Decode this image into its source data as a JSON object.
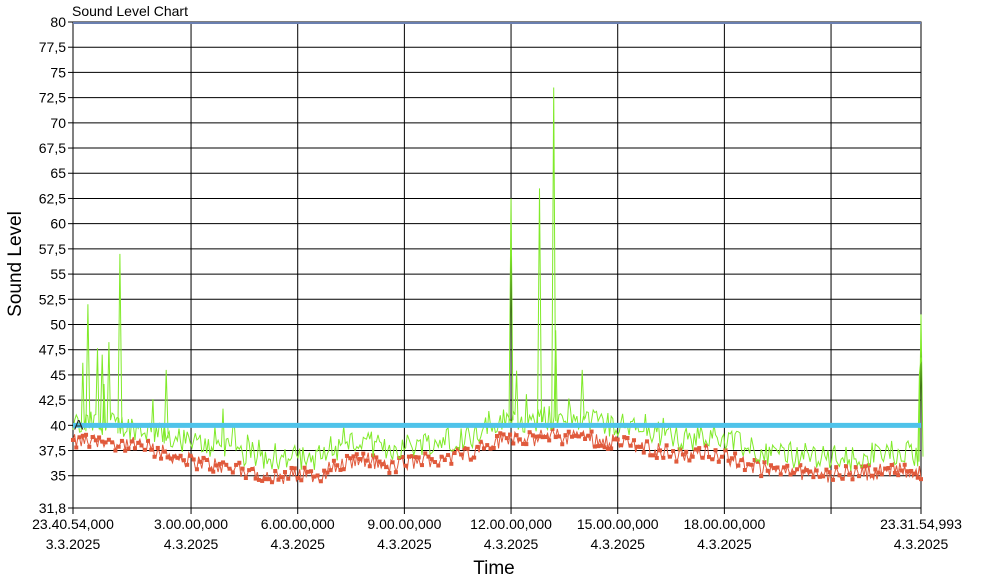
{
  "chart_data": {
    "type": "line",
    "title": "Sound Level Chart",
    "xlabel": "Time",
    "ylabel": "Sound Level",
    "ylim": [
      31.8,
      80
    ],
    "yticks": [
      "31,8",
      "35",
      "37,5",
      "40",
      "42,5",
      "45",
      "47,5",
      "50",
      "52,5",
      "55",
      "57,5",
      "60",
      "62,5",
      "65",
      "67,5",
      "70",
      "72,5",
      "75",
      "77,5",
      "80"
    ],
    "ytick_values": [
      31.8,
      35,
      37.5,
      40,
      42.5,
      45,
      47.5,
      50,
      52.5,
      55,
      57.5,
      60,
      62.5,
      65,
      67.5,
      70,
      72.5,
      75,
      77.5,
      80
    ],
    "x_range_hours": [
      -0.32,
      23.53
    ],
    "xtick_hours": [
      -0.32,
      3,
      6,
      9,
      12,
      15,
      18,
      21,
      23.53
    ],
    "xticks": [
      {
        "time": "23.40.54,000",
        "date": "3.3.2025"
      },
      {
        "time": "3.00.00,000",
        "date": "4.3.2025"
      },
      {
        "time": "6.00.00,000",
        "date": "4.3.2025"
      },
      {
        "time": "9.00.00,000",
        "date": "4.3.2025"
      },
      {
        "time": "12.00.00,000",
        "date": "4.3.2025"
      },
      {
        "time": "15.00.00,000",
        "date": "4.3.2025"
      },
      {
        "time": "18.00.00,000",
        "date": "4.3.2025"
      },
      {
        "time": "",
        "date": ""
      },
      {
        "time": "23.31.54,993",
        "date": "4.3.2025"
      }
    ],
    "threshold": {
      "label": "A",
      "value": 40,
      "color": "#4fc3ea"
    },
    "series": [
      {
        "color": "#80ea2a",
        "points": [
          [
            -0.32,
            38.5
          ],
          [
            0.1,
            52
          ],
          [
            0.5,
            47
          ],
          [
            1.0,
            57
          ],
          [
            1.4,
            45
          ],
          [
            1.8,
            42
          ],
          [
            2.3,
            45.5
          ],
          [
            2.8,
            41
          ],
          [
            3.5,
            39
          ],
          [
            4.2,
            39.5
          ],
          [
            4.8,
            37
          ],
          [
            5.3,
            36.2
          ],
          [
            5.7,
            35.1
          ],
          [
            6.2,
            35.5
          ],
          [
            6.6,
            35.3
          ],
          [
            7.0,
            38.5
          ],
          [
            7.4,
            37.8
          ],
          [
            7.8,
            38
          ],
          [
            8.2,
            37.2
          ],
          [
            8.6,
            36.5
          ],
          [
            9.0,
            36.8
          ],
          [
            9.5,
            37.5
          ],
          [
            10.0,
            37.8
          ],
          [
            10.6,
            37.5
          ],
          [
            11.2,
            38.5
          ],
          [
            11.6,
            39.5
          ],
          [
            12.0,
            62.5
          ],
          [
            12.4,
            42.5
          ],
          [
            12.8,
            63.5
          ],
          [
            13.2,
            73.5
          ],
          [
            13.6,
            44
          ],
          [
            14.0,
            45.5
          ],
          [
            14.5,
            39
          ],
          [
            15.0,
            41
          ],
          [
            15.5,
            39
          ],
          [
            16.0,
            38.5
          ],
          [
            16.5,
            38
          ],
          [
            17.0,
            37.5
          ],
          [
            17.5,
            38.5
          ],
          [
            18.0,
            38.8
          ],
          [
            18.5,
            37
          ],
          [
            19.0,
            36.2
          ],
          [
            19.5,
            35.8
          ],
          [
            20.0,
            35.6
          ],
          [
            20.5,
            35.5
          ],
          [
            21.0,
            35.3
          ],
          [
            21.5,
            35.4
          ],
          [
            22.0,
            35.6
          ],
          [
            22.5,
            35.7
          ],
          [
            23.0,
            35.9
          ],
          [
            23.53,
            51
          ]
        ]
      },
      {
        "color": "#e05a3c",
        "points": [
          [
            -0.32,
            38.3
          ],
          [
            0.5,
            38.5
          ],
          [
            1.0,
            38.2
          ],
          [
            1.5,
            38
          ],
          [
            2.0,
            37.5
          ],
          [
            2.5,
            37
          ],
          [
            3.0,
            36.5
          ],
          [
            3.5,
            36.2
          ],
          [
            4.0,
            35.8
          ],
          [
            4.5,
            35.4
          ],
          [
            5.0,
            35.2
          ],
          [
            5.5,
            34.9
          ],
          [
            6.0,
            35.1
          ],
          [
            6.5,
            35.0
          ],
          [
            7.0,
            35.8
          ],
          [
            7.5,
            36.5
          ],
          [
            8.0,
            36.5
          ],
          [
            8.5,
            35.8
          ],
          [
            9.0,
            36.2
          ],
          [
            9.5,
            36.5
          ],
          [
            10.0,
            36.8
          ],
          [
            10.5,
            37.0
          ],
          [
            11.0,
            37.5
          ],
          [
            11.5,
            38.2
          ],
          [
            12.0,
            39.0
          ],
          [
            12.5,
            38.5
          ],
          [
            13.0,
            39.0
          ],
          [
            13.5,
            38.8
          ],
          [
            14.0,
            39.0
          ],
          [
            14.5,
            38.5
          ],
          [
            15.0,
            38.3
          ],
          [
            15.5,
            38.0
          ],
          [
            16.0,
            37.6
          ],
          [
            16.5,
            37.2
          ],
          [
            17.0,
            36.8
          ],
          [
            17.5,
            37.5
          ],
          [
            18.0,
            37.0
          ],
          [
            18.5,
            36.2
          ],
          [
            19.0,
            35.6
          ],
          [
            19.5,
            35.4
          ],
          [
            20.0,
            35.3
          ],
          [
            20.5,
            35.2
          ],
          [
            21.0,
            35.1
          ],
          [
            21.5,
            35.2
          ],
          [
            22.0,
            35.3
          ],
          [
            22.5,
            35.5
          ],
          [
            23.0,
            35.6
          ],
          [
            23.53,
            35.4
          ]
        ]
      }
    ],
    "grid": true,
    "legend": "none"
  }
}
